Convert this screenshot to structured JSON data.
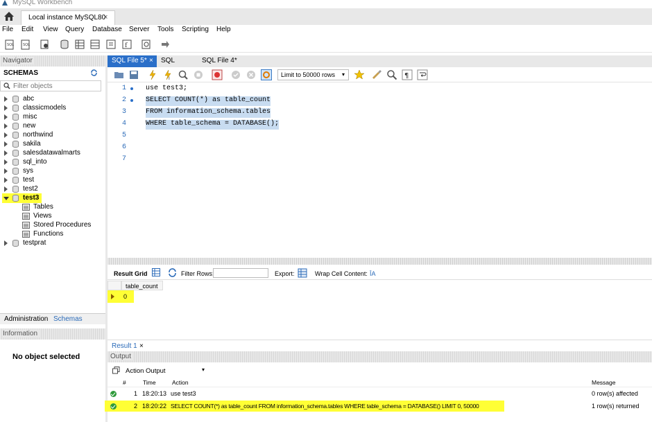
{
  "window": {
    "title": "MySQL Workbench"
  },
  "connection_tab": {
    "label": "Local instance MySQL80",
    "close": "×"
  },
  "menu": [
    "File",
    "Edit",
    "View",
    "Query",
    "Database",
    "Server",
    "Tools",
    "Scripting",
    "Help"
  ],
  "navigator": {
    "header": "Navigator",
    "schemas_title": "SCHEMAS",
    "filter_placeholder": "Filter objects",
    "schemas": [
      "abc",
      "classicmodels",
      "misc",
      "new",
      "northwind",
      "sakila",
      "salesdatawalmarts",
      "sql_into",
      "sys",
      "test",
      "test2"
    ],
    "active_schema": "test3",
    "active_children": [
      "Tables",
      "Views",
      "Stored Procedures",
      "Functions"
    ],
    "after": [
      "testprat"
    ]
  },
  "bottom_tabs": {
    "admin": "Administration",
    "schemas": "Schemas"
  },
  "info": {
    "header": "Information",
    "empty": "No object selected"
  },
  "query_tabs": [
    {
      "label": "SQL File 5*",
      "close": "×",
      "active": true
    },
    {
      "label": "SQL",
      "active": false
    },
    {
      "label": "SQL File 4*",
      "active": false
    }
  ],
  "query_toolbar": {
    "limit": "Limit to 50000 rows"
  },
  "editor": {
    "line_numbers": [
      "1",
      "2",
      "3",
      "4",
      "5",
      "6",
      "7"
    ],
    "lines": [
      "use test3;",
      "SELECT COUNT(*) as table_count",
      "FROM information_schema.tables",
      "WHERE table_schema = DATABASE();"
    ]
  },
  "result_bar": {
    "grid": "Result Grid",
    "filter": "Filter Rows:",
    "export": "Export:",
    "wrap": "Wrap Cell Content:",
    "wrap_icon": "ĪA"
  },
  "result_grid": {
    "columns": [
      "table_count"
    ],
    "rows": [
      [
        "0"
      ]
    ]
  },
  "result_tabs": {
    "result": "Result 1",
    "close": "×"
  },
  "output": {
    "header": "Output",
    "mode": "Action Output",
    "columns": {
      "num": "#",
      "time": "Time",
      "action": "Action",
      "message": "Message"
    },
    "rows": [
      {
        "num": "1",
        "time": "18:20:13",
        "action": "use test3",
        "message": "0 row(s) affected"
      },
      {
        "num": "2",
        "time": "18:20:22",
        "action": "SELECT COUNT(*) as table_count FROM information_schema.tables WHERE table_schema = DATABASE() LIMIT 0, 50000",
        "message": "1 row(s) returned"
      }
    ]
  },
  "colors": {
    "accent": "#2a6fc9",
    "highlight": "#ffff35",
    "selection": "#c8dcf1",
    "success": "#2e9a3a"
  }
}
